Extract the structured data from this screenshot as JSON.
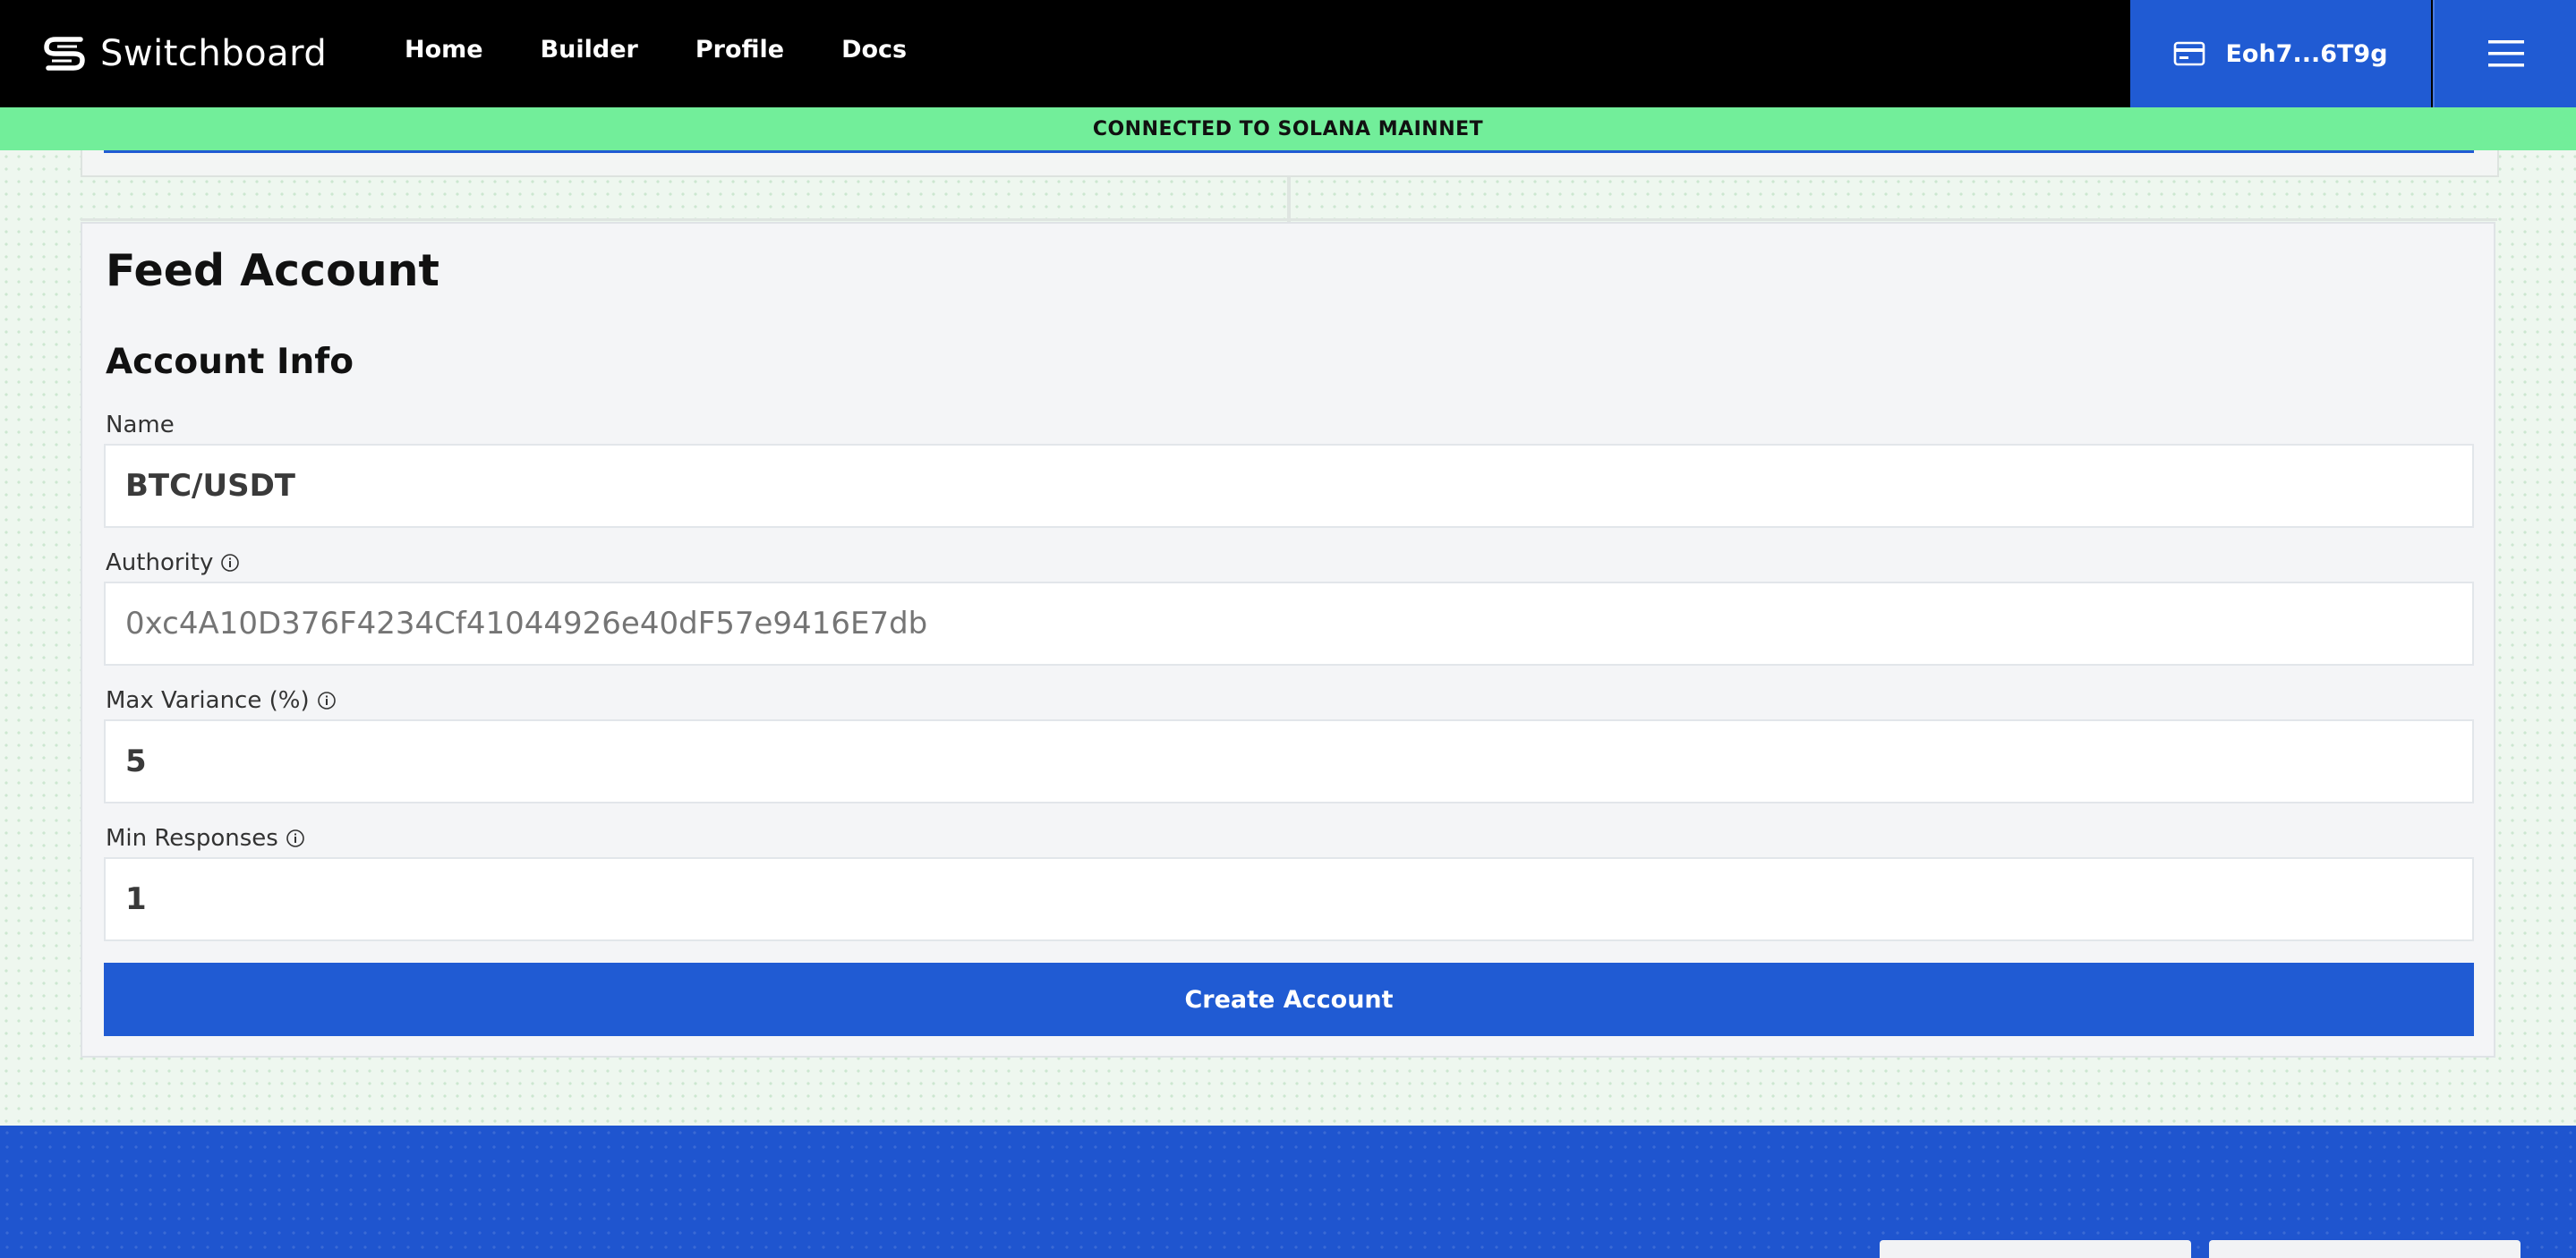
{
  "nav": {
    "logo_text": "Switchboard",
    "links": [
      "Home",
      "Builder",
      "Profile",
      "Docs"
    ],
    "wallet_label": "Eoh7...6T9g"
  },
  "banner": {
    "text": "CONNECTED TO SOLANA MAINNET"
  },
  "card": {
    "title": "Feed Account",
    "section_title": "Account Info",
    "fields": [
      {
        "label": "Name",
        "value": "BTC/USDT",
        "placeholder": ""
      },
      {
        "label": "Authority",
        "value": "",
        "placeholder": "0xc4A10D376F4234Cf41044926e40dF57e9416E7db"
      },
      {
        "label": "Max Variance (%)",
        "value": "5",
        "placeholder": ""
      },
      {
        "label": "Min Responses",
        "value": "1",
        "placeholder": ""
      }
    ],
    "submit_label": "Create Account"
  },
  "colors": {
    "brand_blue": "#205bd3",
    "banner_green": "#72ee9a",
    "nav_bg": "#000000"
  },
  "icons": {
    "logo": "switchboard-logo-icon",
    "wallet": "credit-card-icon",
    "menu": "hamburger-menu-icon",
    "info": "info-icon"
  }
}
